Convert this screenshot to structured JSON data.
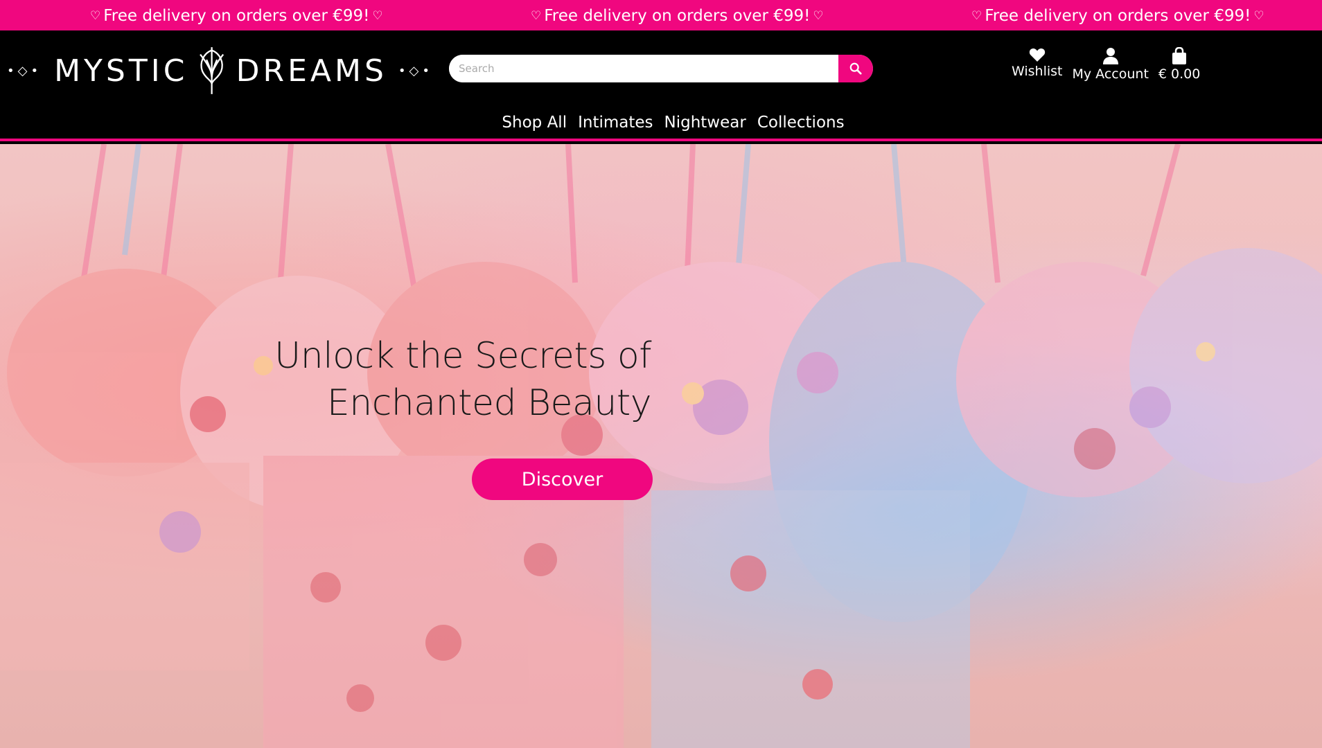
{
  "announcement": {
    "messages": [
      "Free delivery on orders over €99!",
      "Free delivery on orders over €99!",
      "Free delivery on orders over €99!"
    ],
    "heart_icon": "heart-outline-icon"
  },
  "brand": {
    "name_left": "MYSTIC",
    "name_right": "DREAMS",
    "emblem": "leaf-emblem-icon",
    "color_primary": "#f0077f",
    "color_header": "#000000"
  },
  "search": {
    "placeholder": "Search",
    "button_icon": "search-icon"
  },
  "account": {
    "wishlist_label": "Wishlist",
    "wishlist_icon": "heart-icon",
    "account_label": "My Account",
    "account_icon": "user-icon",
    "cart_label": "€ 0.00",
    "cart_icon": "shopping-bag-icon"
  },
  "nav": {
    "items": [
      "Shop All",
      "Intimates",
      "Nightwear",
      "Collections"
    ]
  },
  "hero": {
    "title_line1": "Unlock the Secrets of",
    "title_line2": "Enchanted Beauty",
    "cta_label": "Discover"
  }
}
